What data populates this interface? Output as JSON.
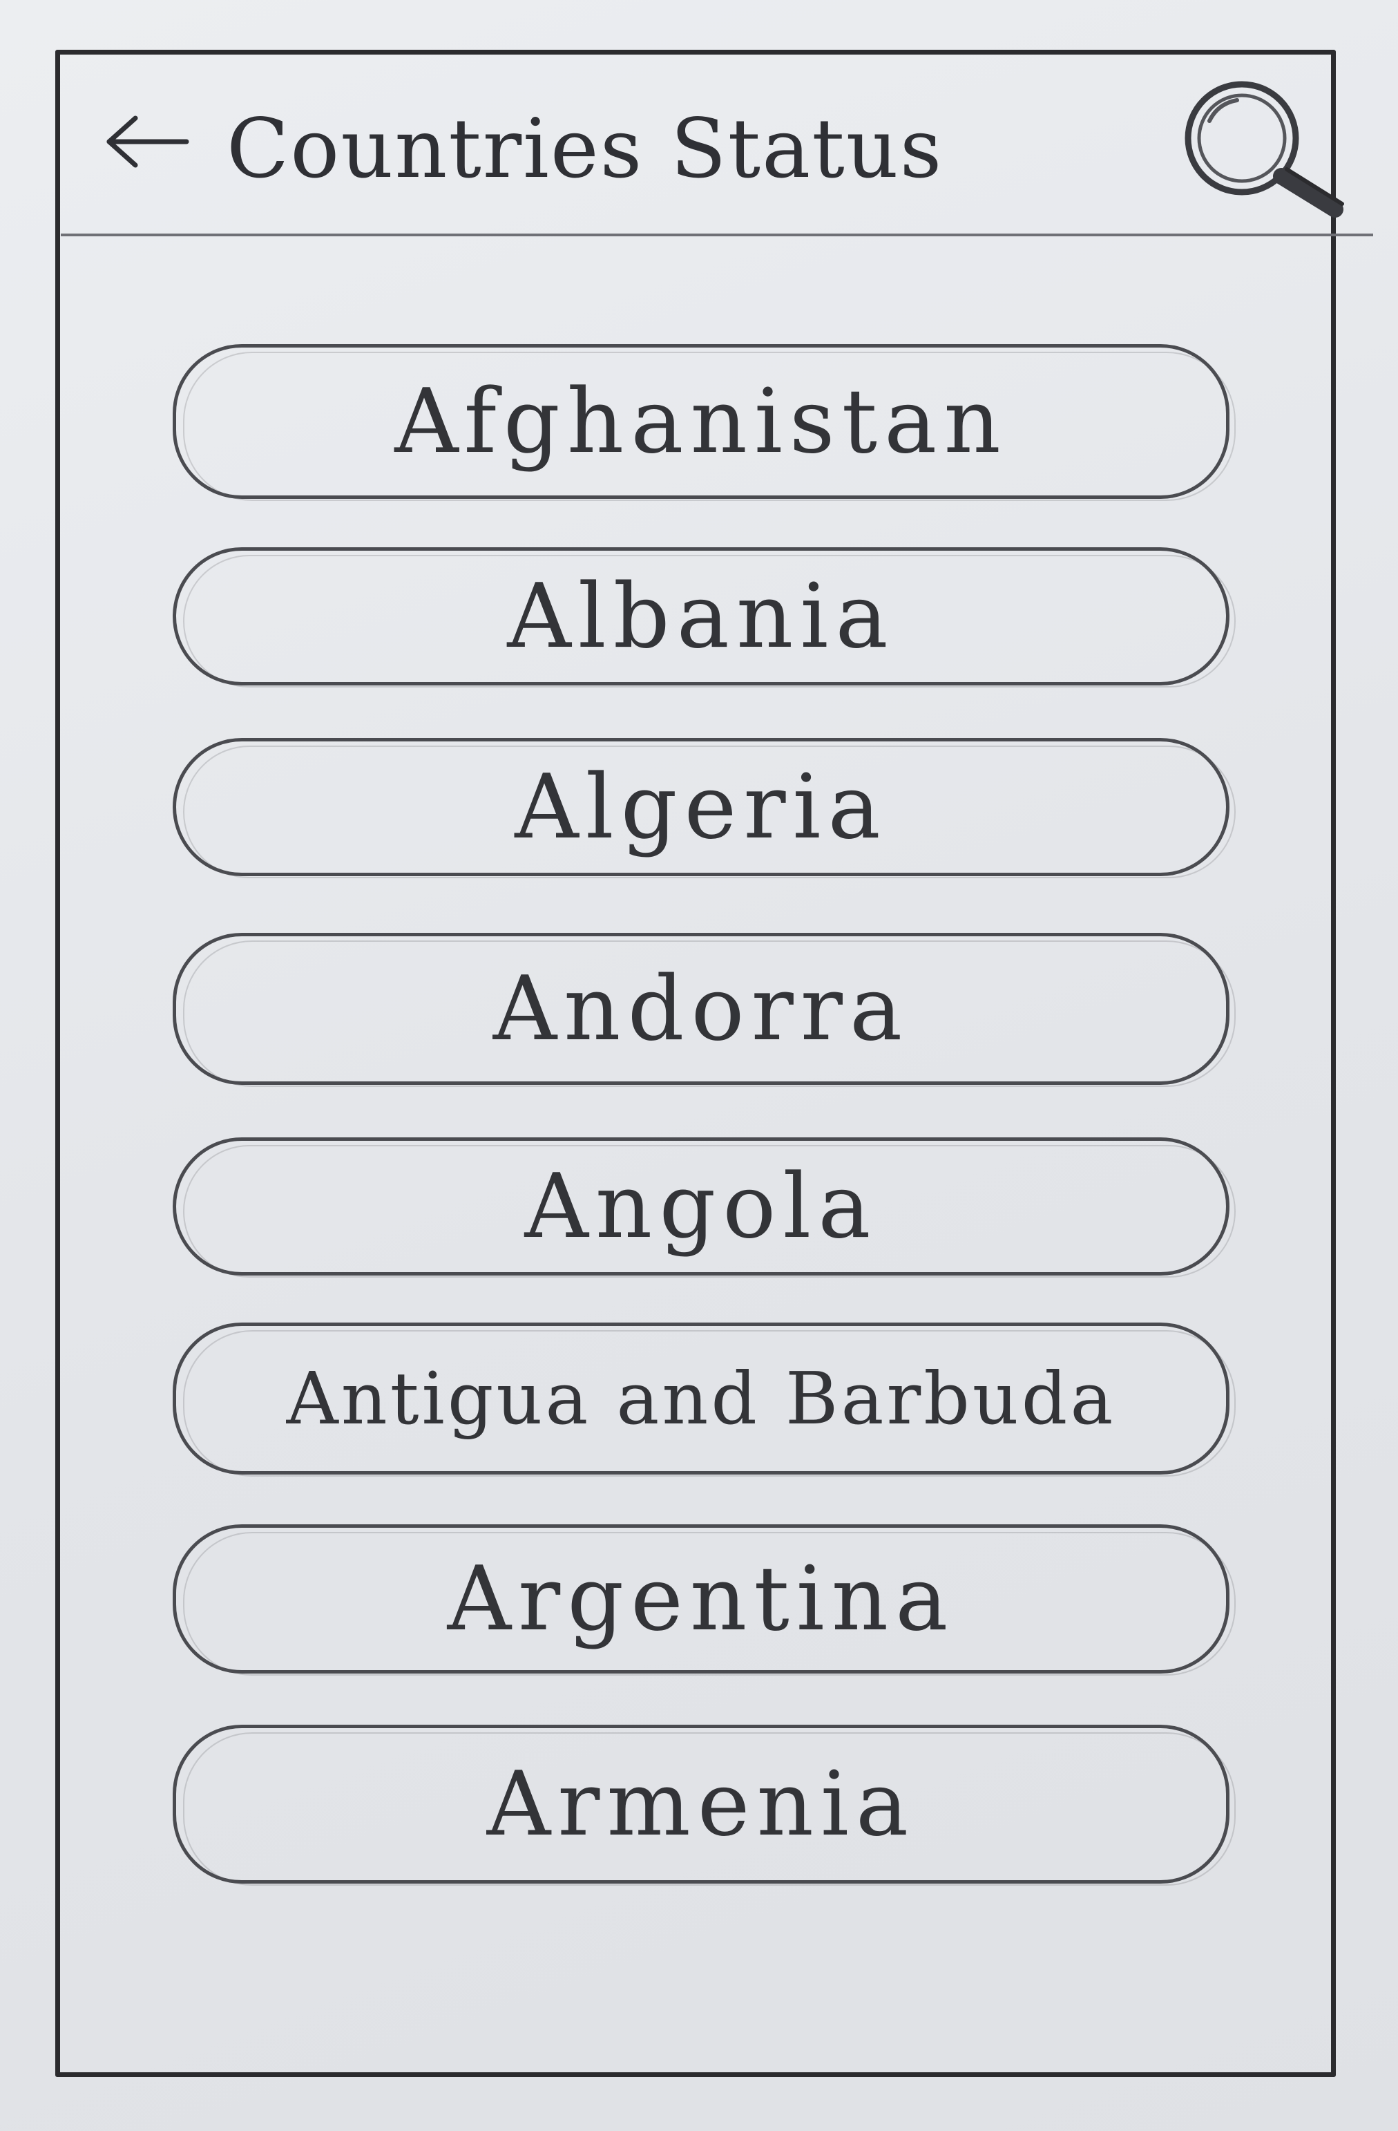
{
  "app_bar": {
    "back_icon": "arrow-left-icon",
    "title": "Countries Status",
    "search_icon": "magnifier-icon"
  },
  "countries": [
    "Afghanistan",
    "Albania",
    "Algeria",
    "Andorra",
    "Angola",
    "Antigua and Barbuda",
    "Argentina",
    "Armenia"
  ],
  "colors": {
    "paper": "#e7e8ec",
    "pencil": "#2b2b2e"
  }
}
